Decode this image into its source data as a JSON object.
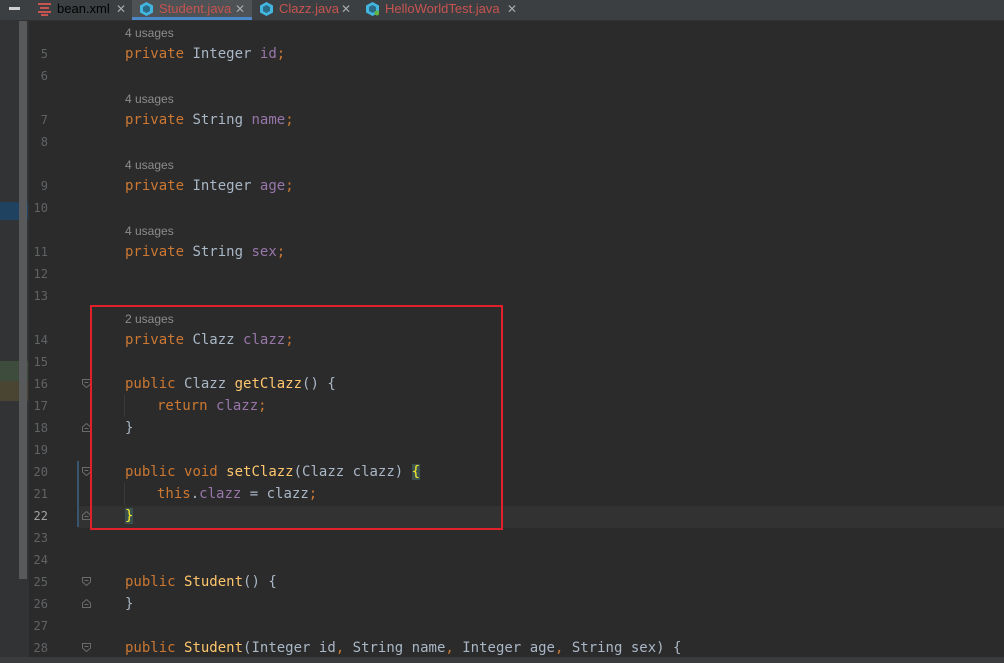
{
  "tabs": [
    {
      "label": "bean.xml",
      "icon": "xml-file-icon",
      "color": "#c75450",
      "active": false
    },
    {
      "label": "Student.java",
      "icon": "java-class-icon",
      "color": "#c75450",
      "active": true
    },
    {
      "label": "Clazz.java",
      "icon": "java-class-icon",
      "color": "#c75450",
      "active": false
    },
    {
      "label": "HelloWorldTest.java",
      "icon": "java-test-class-icon",
      "color": "#c75450",
      "active": false
    }
  ],
  "close_glyph": "✕",
  "editor": {
    "current_line": "22",
    "line_numbers": [
      "5",
      "6",
      "7",
      "8",
      "9",
      "10",
      "11",
      "12",
      "13",
      "14",
      "15",
      "16",
      "17",
      "18",
      "19",
      "20",
      "21",
      "22",
      "23",
      "24",
      "25",
      "26",
      "27",
      "28"
    ],
    "usages": [
      "4 usages",
      "4 usages",
      "4 usages",
      "4 usages",
      "2 usages"
    ],
    "code": {
      "l5": {
        "k": "private",
        "t": "Integer",
        "f": "id",
        "p": ";"
      },
      "l7": {
        "k": "private",
        "t": "String",
        "f": "name",
        "p": ";"
      },
      "l9": {
        "k": "private",
        "t": "Integer",
        "f": "age",
        "p": ";"
      },
      "l11": {
        "k": "private",
        "t": "String",
        "f": "sex",
        "p": ";"
      },
      "l14": {
        "k": "private",
        "t": "Clazz",
        "f": "clazz",
        "p": ";"
      },
      "l16": {
        "k": "public",
        "t": "Clazz",
        "m": "getClazz",
        "paren": "()",
        "b": "{"
      },
      "l17": {
        "k": "return",
        "f": "clazz",
        "p": ";"
      },
      "l18": {
        "b": "}"
      },
      "l20": {
        "k": "public",
        "k2": "void",
        "m": "setClazz",
        "open": "(",
        "t": "Clazz",
        "a": "clazz",
        "close": ")",
        "b": "{"
      },
      "l21": {
        "k": "this",
        "dot": ".",
        "f": "clazz",
        "eq": " = ",
        "a": "clazz",
        "p": ";"
      },
      "l22": {
        "b": "}"
      },
      "l25": {
        "k": "public",
        "m": "Student",
        "paren": "()",
        "b": "{"
      },
      "l26": {
        "b": "}"
      },
      "l28": {
        "k": "public",
        "m": "Student",
        "open": "(",
        "t1": "Integer",
        "a1": "id",
        "c1": ", ",
        "t2": "String",
        "a2": "name",
        "c2": ", ",
        "t3": "Integer",
        "a3": "age",
        "c3": ", ",
        "t4": "String",
        "a4": "sex",
        "close": ")",
        "b": "{"
      }
    }
  }
}
